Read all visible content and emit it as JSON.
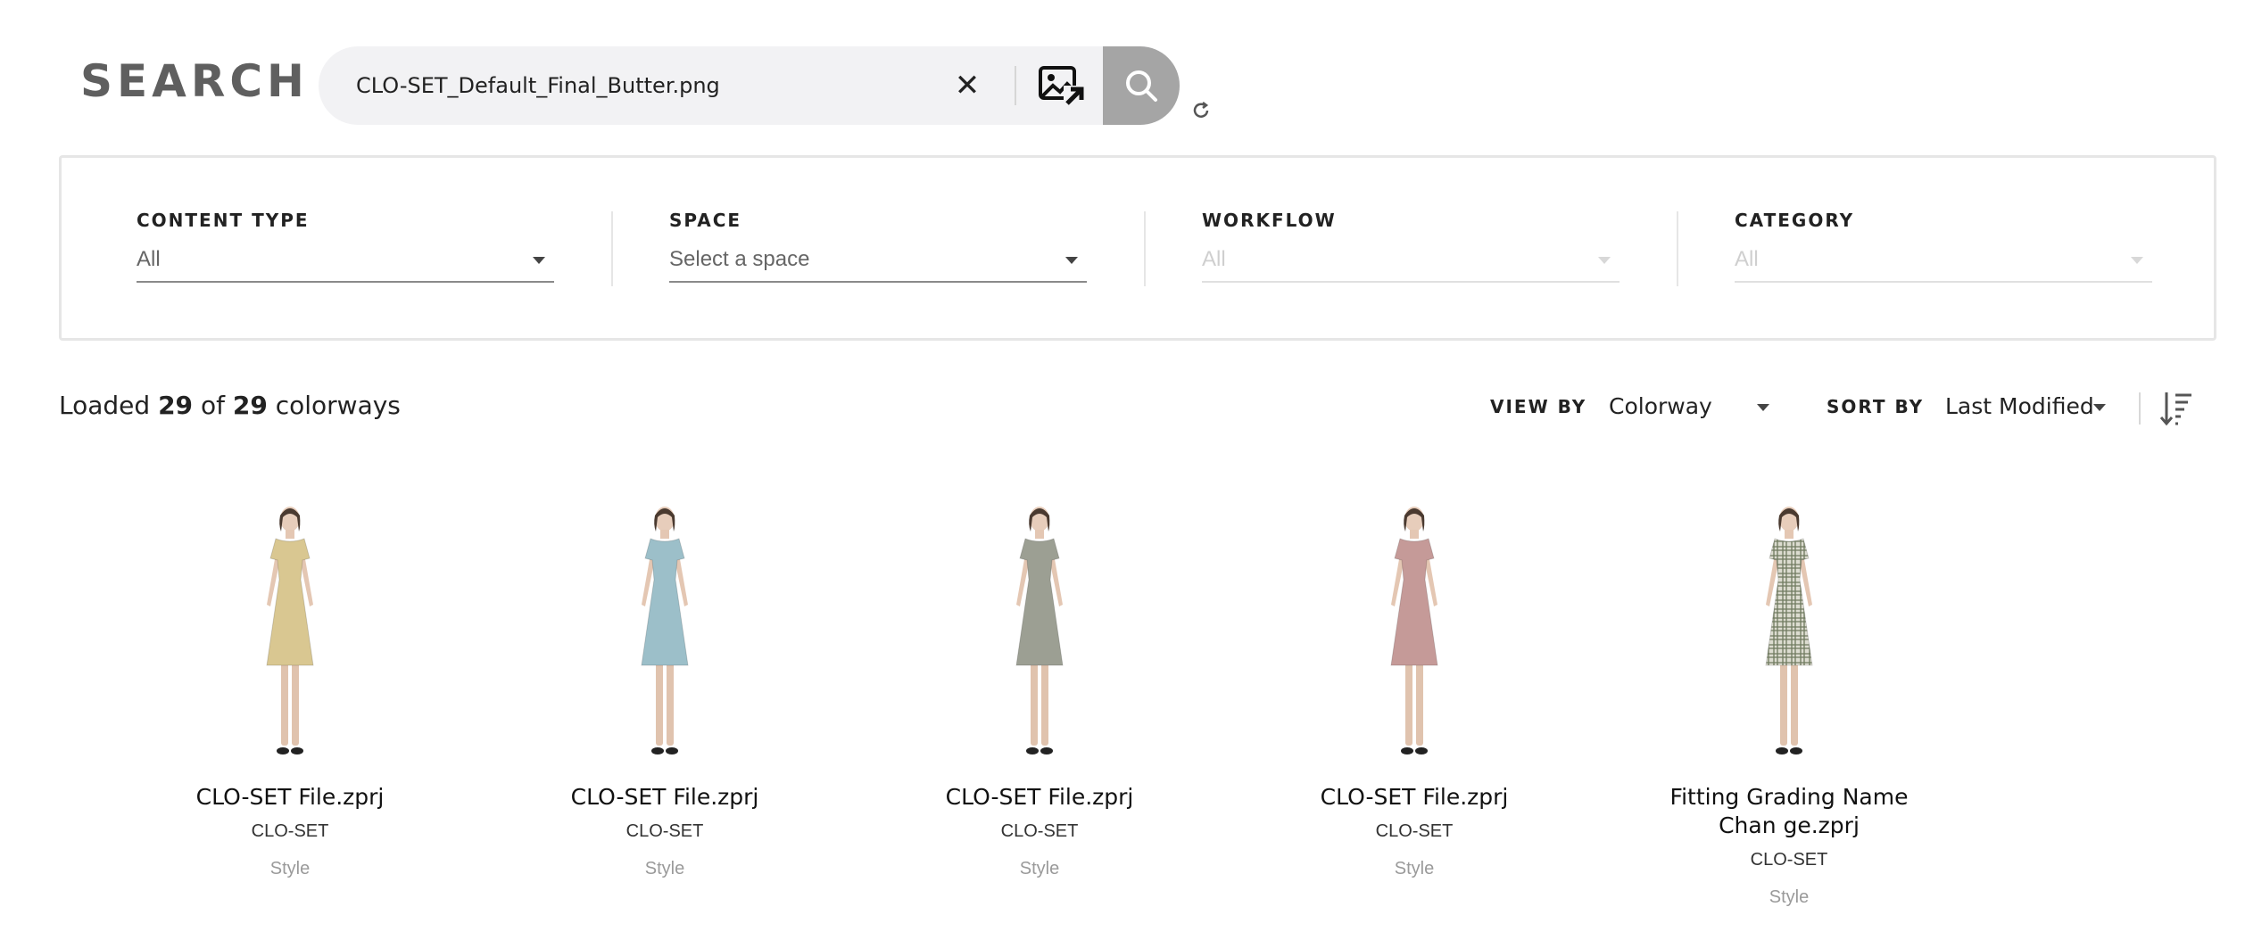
{
  "page": {
    "title": "SEARCH"
  },
  "search": {
    "query": "CLO-SET_Default_Final_Butter.png",
    "clear_icon": "close-icon",
    "image_search_icon": "image-search-icon",
    "search_icon": "search-icon",
    "refresh_icon": "refresh-icon"
  },
  "filters": [
    {
      "label": "CONTENT TYPE",
      "value": "All",
      "disabled": false
    },
    {
      "label": "SPACE",
      "value": "Select a space",
      "disabled": false
    },
    {
      "label": "WORKFLOW",
      "value": "All",
      "disabled": true
    },
    {
      "label": "CATEGORY",
      "value": "All",
      "disabled": true
    }
  ],
  "results": {
    "prefix": "Loaded",
    "loaded": "29",
    "of": "of",
    "total": "29",
    "unit": "colorways"
  },
  "toolbar": {
    "view_by_label": "VIEW BY",
    "view_by_value": "Colorway",
    "sort_by_label": "SORT BY",
    "sort_by_value": "Last Modified",
    "sort_order_icon": "sort-descending-icon"
  },
  "cards": [
    {
      "name": "CLO-SET File.zprj",
      "space": "CLO-SET",
      "type": "Style",
      "color": "#d9c791",
      "pattern": "solid"
    },
    {
      "name": "CLO-SET File.zprj",
      "space": "CLO-SET",
      "type": "Style",
      "color": "#9cbfc9",
      "pattern": "solid"
    },
    {
      "name": "CLO-SET File.zprj",
      "space": "CLO-SET",
      "type": "Style",
      "color": "#9c9f93",
      "pattern": "solid"
    },
    {
      "name": "CLO-SET File.zprj",
      "space": "CLO-SET",
      "type": "Style",
      "color": "#c59a98",
      "pattern": "solid"
    },
    {
      "name": "Fitting Grading Name Chan ge.zprj",
      "space": "CLO-SET",
      "type": "Style",
      "color": "#dcdcd0",
      "pattern": "plaid"
    }
  ]
}
